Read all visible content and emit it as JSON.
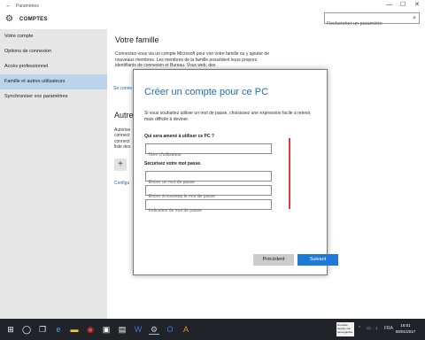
{
  "window": {
    "title": "Paramètres",
    "minimize": "—",
    "maximize": "☐",
    "close": "✕"
  },
  "header": {
    "section": "COMPTES",
    "search_placeholder": "Rechercher un paramètre"
  },
  "sidebar": {
    "items": [
      {
        "label": "Votre compte"
      },
      {
        "label": "Options de connexion"
      },
      {
        "label": "Accès professionnel"
      },
      {
        "label": "Famille et autres utilisateurs"
      },
      {
        "label": "Synchroniser vos paramètres"
      }
    ]
  },
  "main": {
    "family_title": "Votre famille",
    "family_desc": "Connectez-vous via un compte Microsoft pour voir votre famille ou y ajouter de nouveaux membres. Les membres de la famille possèdent leurs propres identifiants de connexion et Bureau. Vous web, des",
    "family_link": "Se conne",
    "other_title": "Autre",
    "other_desc": "Autorise connect connect liste des",
    "other_link": "Configu"
  },
  "dialog": {
    "title": "Créer un compte pour ce PC",
    "intro": "Si vous souhaitez utiliser un mot de passe, choisissez une expression facile à retenir, mais difficile à deviner.",
    "q_user": "Qui sera amené à utiliser ce PC ?",
    "username_placeholder": "Nom d'utilisateur",
    "q_password": "Sécurisez votre mot passe.",
    "password_placeholder": "Entrer un mot de passe",
    "password_confirm_placeholder": "Entrer à nouveau le mot de passe",
    "hint_placeholder": "Indication de mot de passe",
    "prev_label": "Précédent",
    "next_label": "Suivant"
  },
  "taskbar": {
    "notification": "Nouvelle fenêtre non sauvegardée",
    "lang": "FRA",
    "time": "16:01",
    "date": "06/01/2017"
  },
  "colors": {
    "accent": "#1e7ad4",
    "sidebar_active": "#bcd3ec",
    "annotation": "#e03a3a"
  }
}
